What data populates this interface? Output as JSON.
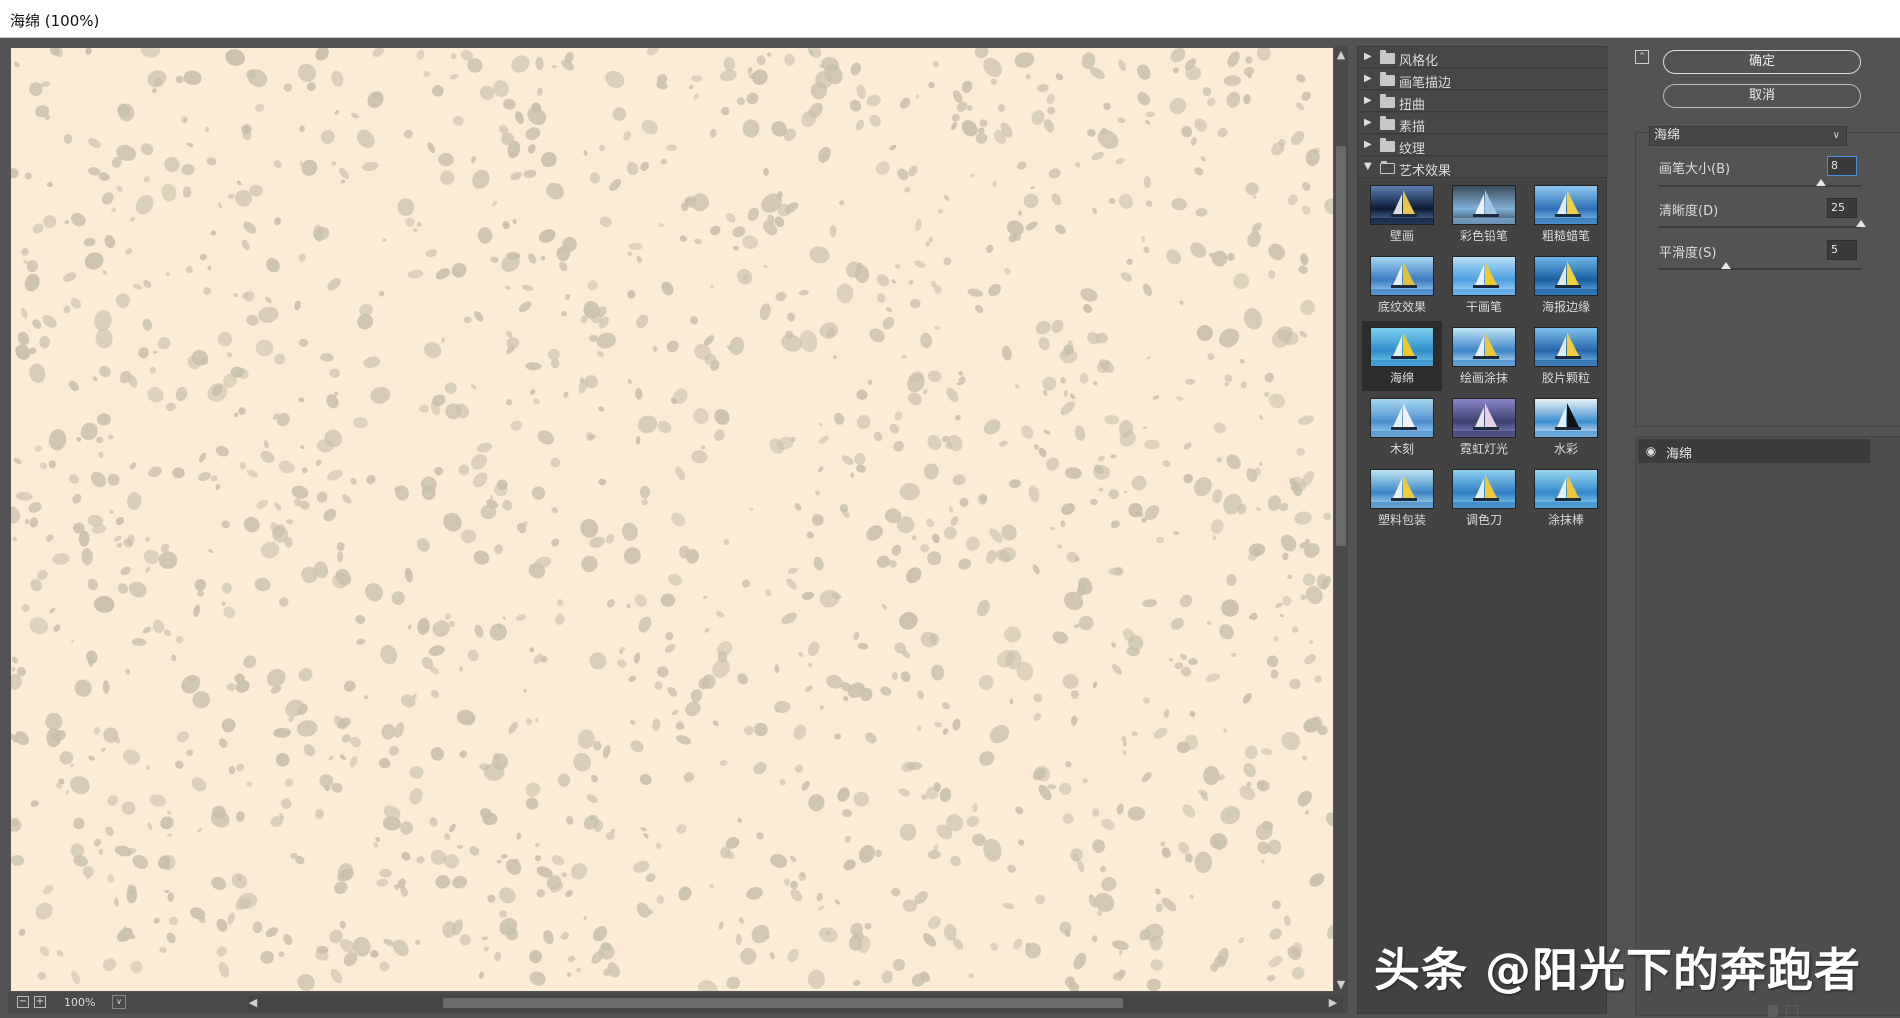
{
  "window": {
    "title": "海绵 (100%)"
  },
  "preview": {
    "zoom": "100%",
    "texture": "sponge-speckle",
    "base_color": "#fcecd6",
    "speck_color": "#c8bfa9"
  },
  "gallery": {
    "folders": [
      {
        "label": "风格化",
        "open": false
      },
      {
        "label": "画笔描边",
        "open": false
      },
      {
        "label": "扭曲",
        "open": false
      },
      {
        "label": "素描",
        "open": false
      },
      {
        "label": "纹理",
        "open": false
      },
      {
        "label": "艺术效果",
        "open": true
      }
    ],
    "filters": [
      {
        "label": "壁画"
      },
      {
        "label": "彩色铅笔"
      },
      {
        "label": "粗糙蜡笔"
      },
      {
        "label": "底纹效果"
      },
      {
        "label": "干画笔"
      },
      {
        "label": "海报边缘"
      },
      {
        "label": "海绵",
        "selected": true
      },
      {
        "label": "绘画涂抹"
      },
      {
        "label": "胶片颗粒"
      },
      {
        "label": "木刻"
      },
      {
        "label": "霓虹灯光"
      },
      {
        "label": "水彩"
      },
      {
        "label": "塑料包装"
      },
      {
        "label": "调色刀"
      },
      {
        "label": "涂抹棒"
      }
    ]
  },
  "settings": {
    "ok_label": "确定",
    "cancel_label": "取消",
    "filter_select": "海绵",
    "params": [
      {
        "label": "画笔大小(B)",
        "value": "8",
        "level": 0.8
      },
      {
        "label": "清晰度(D)",
        "value": "25",
        "level": 1.0
      },
      {
        "label": "平滑度(S)",
        "value": "5",
        "level": 0.33
      }
    ]
  },
  "layers": [
    {
      "label": "海绵",
      "visible": true
    }
  ],
  "watermark": "头条 @阳光下的奔跑者"
}
